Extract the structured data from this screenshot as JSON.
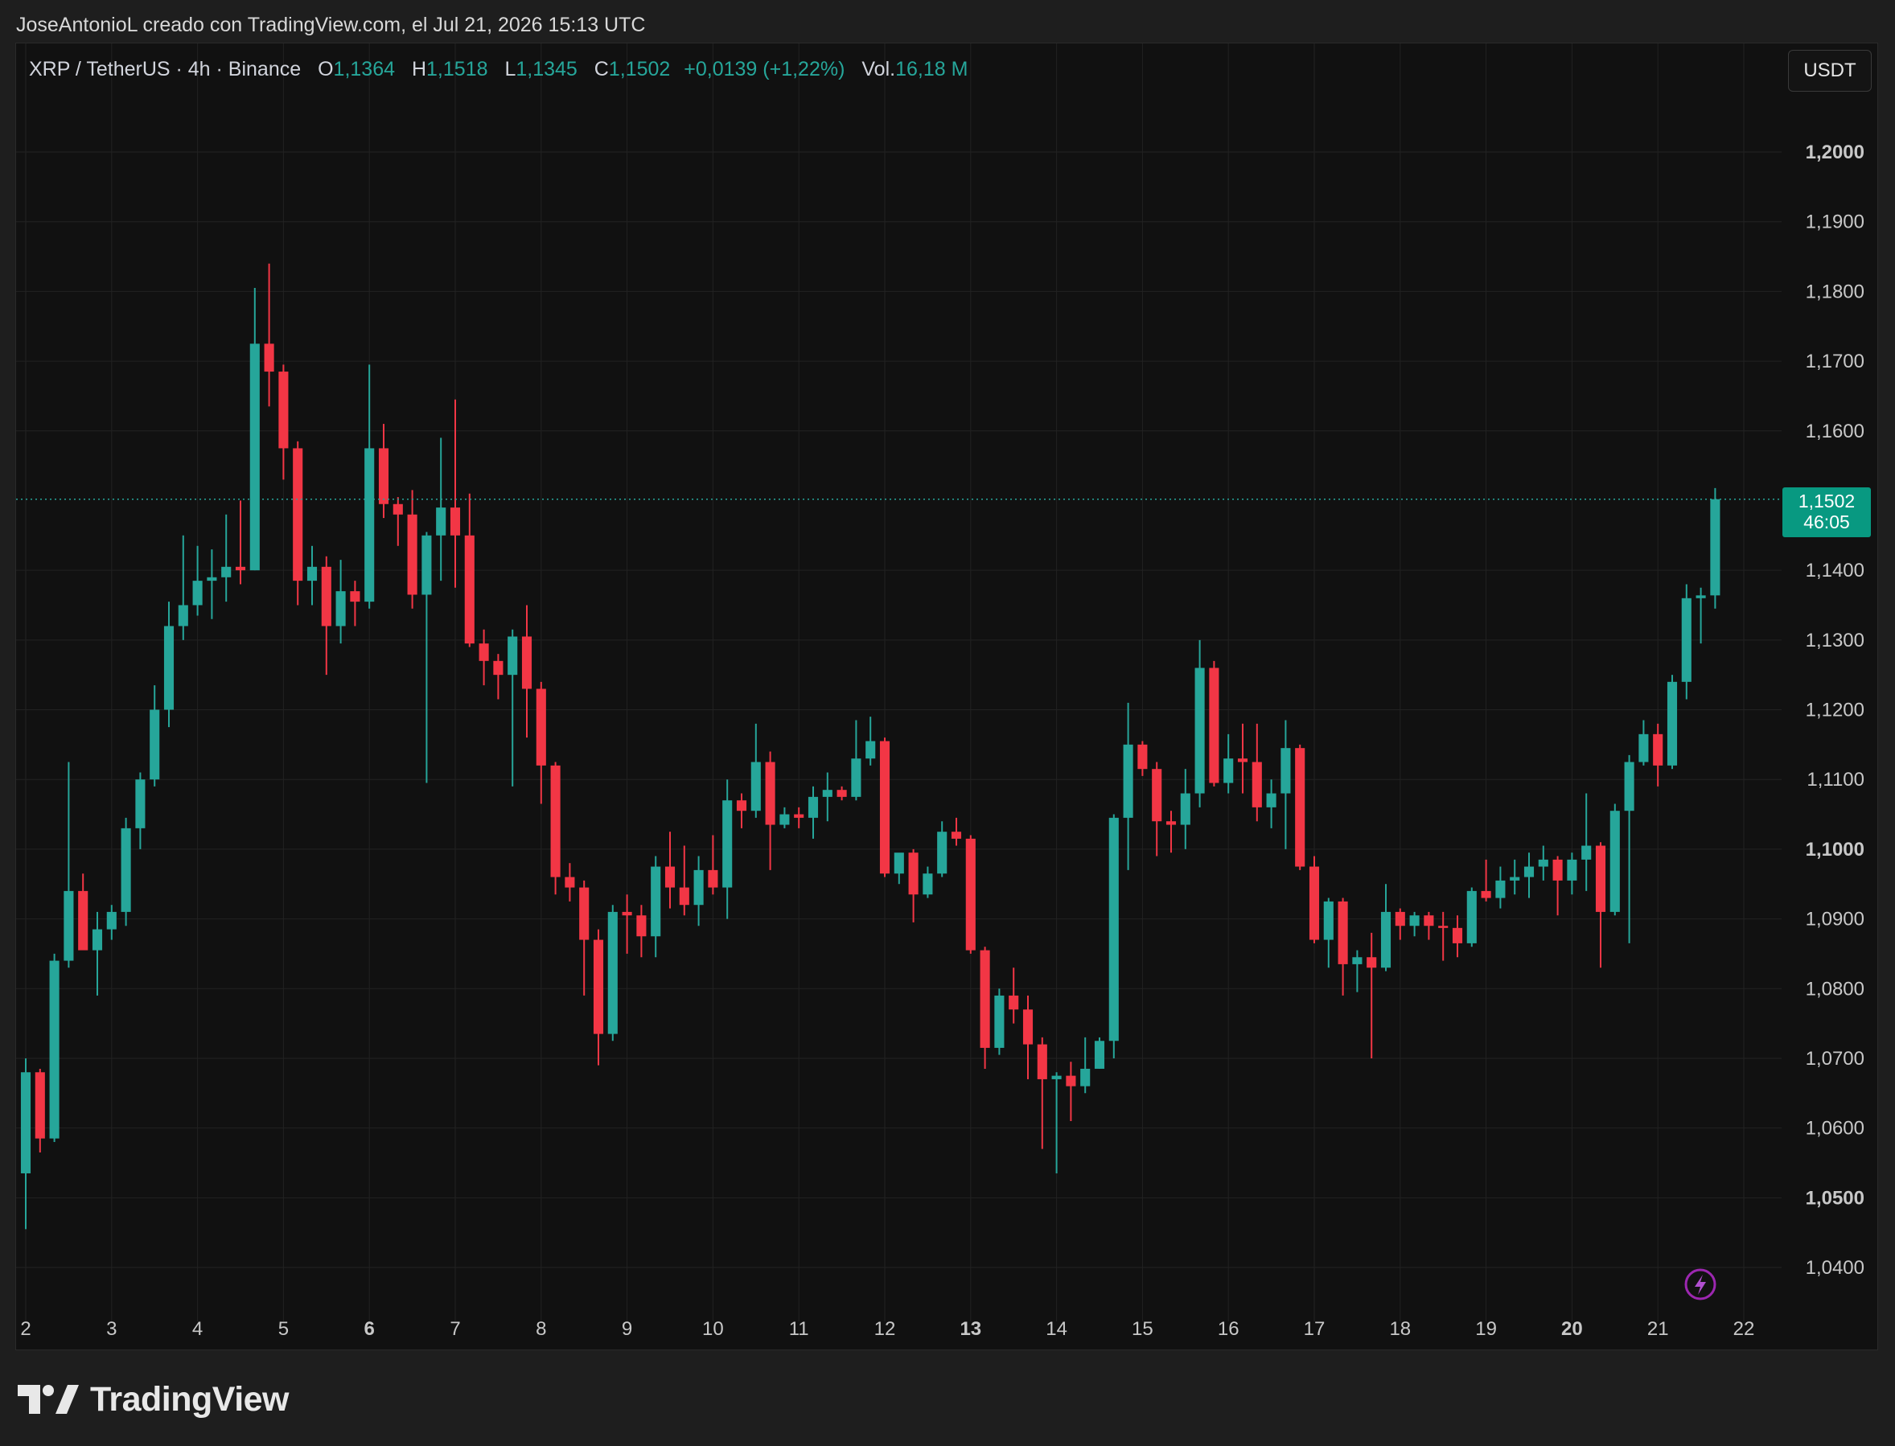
{
  "header": {
    "attribution": "JoseAntonioL creado con TradingView.com, el Jul 21, 2026 15:13 UTC"
  },
  "legend": {
    "symbol": "XRP / TetherUS · 4h · Binance",
    "open_label": "O",
    "open": "1,1364",
    "high_label": "H",
    "high": "1,1518",
    "low_label": "L",
    "low": "1,1345",
    "close_label": "C",
    "close": "1,1502",
    "change": "+0,0139 (+1,22%)",
    "volume_label": "Vol.",
    "volume": "16,18 M"
  },
  "currency_button": "USDT",
  "price_tag": {
    "price": "1,1502",
    "countdown": "46:05"
  },
  "brand": {
    "name": "TradingView"
  },
  "colors": {
    "up": "#26a69a",
    "down": "#f23645",
    "background": "#111111",
    "grid": "#222222",
    "text": "#c8c8c8"
  },
  "icons": {
    "brand": "tradingview-logo-icon",
    "flash": "lightning-icon"
  },
  "chart_data": {
    "type": "candlestick",
    "title": "XRP / TetherUS · 4h · Binance",
    "x_ticks": [
      {
        "label": "2",
        "bold": false
      },
      {
        "label": "3",
        "bold": false
      },
      {
        "label": "4",
        "bold": false
      },
      {
        "label": "5",
        "bold": false
      },
      {
        "label": "6",
        "bold": true
      },
      {
        "label": "7",
        "bold": false
      },
      {
        "label": "8",
        "bold": false
      },
      {
        "label": "9",
        "bold": false
      },
      {
        "label": "10",
        "bold": false
      },
      {
        "label": "11",
        "bold": false
      },
      {
        "label": "12",
        "bold": false
      },
      {
        "label": "13",
        "bold": true
      },
      {
        "label": "14",
        "bold": false
      },
      {
        "label": "15",
        "bold": false
      },
      {
        "label": "16",
        "bold": false
      },
      {
        "label": "17",
        "bold": false
      },
      {
        "label": "18",
        "bold": false
      },
      {
        "label": "19",
        "bold": false
      },
      {
        "label": "20",
        "bold": true
      },
      {
        "label": "21",
        "bold": false
      },
      {
        "label": "22",
        "bold": false
      }
    ],
    "y_ticks": [
      {
        "value": 1.04,
        "label": "1,0400",
        "bold": false
      },
      {
        "value": 1.05,
        "label": "1,0500",
        "bold": true
      },
      {
        "value": 1.06,
        "label": "1,0600",
        "bold": false
      },
      {
        "value": 1.07,
        "label": "1,0700",
        "bold": false
      },
      {
        "value": 1.08,
        "label": "1,0800",
        "bold": false
      },
      {
        "value": 1.09,
        "label": "1,0900",
        "bold": false
      },
      {
        "value": 1.1,
        "label": "1,1000",
        "bold": true
      },
      {
        "value": 1.11,
        "label": "1,1100",
        "bold": false
      },
      {
        "value": 1.12,
        "label": "1,1200",
        "bold": false
      },
      {
        "value": 1.13,
        "label": "1,1300",
        "bold": false
      },
      {
        "value": 1.14,
        "label": "1,1400",
        "bold": false
      },
      {
        "value": 1.16,
        "label": "1,1600",
        "bold": false
      },
      {
        "value": 1.17,
        "label": "1,1700",
        "bold": false
      },
      {
        "value": 1.18,
        "label": "1,1800",
        "bold": false
      },
      {
        "value": 1.19,
        "label": "1,1900",
        "bold": false
      },
      {
        "value": 1.2,
        "label": "1,2000",
        "bold": true
      }
    ],
    "ylim": [
      1.0345,
      1.2215
    ],
    "x_start_day": 2,
    "candles_per_day": 6,
    "current_price": 1.1502,
    "grid": true,
    "candles": [
      {
        "o": 1.0535,
        "h": 1.07,
        "l": 1.0455,
        "c": 1.068
      },
      {
        "o": 1.068,
        "h": 1.0685,
        "l": 1.0565,
        "c": 1.0585
      },
      {
        "o": 1.0585,
        "h": 1.085,
        "l": 1.058,
        "c": 1.084
      },
      {
        "o": 1.084,
        "h": 1.1125,
        "l": 1.083,
        "c": 1.094
      },
      {
        "o": 1.094,
        "h": 1.0965,
        "l": 1.086,
        "c": 1.0855
      },
      {
        "o": 1.0855,
        "h": 1.091,
        "l": 1.079,
        "c": 1.0885
      },
      {
        "o": 1.0885,
        "h": 1.092,
        "l": 1.087,
        "c": 1.091
      },
      {
        "o": 1.091,
        "h": 1.1045,
        "l": 1.089,
        "c": 1.103
      },
      {
        "o": 1.103,
        "h": 1.111,
        "l": 1.1,
        "c": 1.11
      },
      {
        "o": 1.11,
        "h": 1.1235,
        "l": 1.109,
        "c": 1.12
      },
      {
        "o": 1.12,
        "h": 1.1355,
        "l": 1.1175,
        "c": 1.132
      },
      {
        "o": 1.132,
        "h": 1.145,
        "l": 1.13,
        "c": 1.135
      },
      {
        "o": 1.135,
        "h": 1.1435,
        "l": 1.1335,
        "c": 1.1385
      },
      {
        "o": 1.1385,
        "h": 1.143,
        "l": 1.133,
        "c": 1.139
      },
      {
        "o": 1.139,
        "h": 1.148,
        "l": 1.1355,
        "c": 1.1405
      },
      {
        "o": 1.1405,
        "h": 1.15,
        "l": 1.138,
        "c": 1.14
      },
      {
        "o": 1.14,
        "h": 1.1805,
        "l": 1.14,
        "c": 1.1725
      },
      {
        "o": 1.1725,
        "h": 1.184,
        "l": 1.1635,
        "c": 1.1685
      },
      {
        "o": 1.1685,
        "h": 1.1695,
        "l": 1.153,
        "c": 1.1575
      },
      {
        "o": 1.1575,
        "h": 1.1585,
        "l": 1.135,
        "c": 1.1385
      },
      {
        "o": 1.1385,
        "h": 1.1435,
        "l": 1.135,
        "c": 1.1405
      },
      {
        "o": 1.1405,
        "h": 1.142,
        "l": 1.125,
        "c": 1.132
      },
      {
        "o": 1.132,
        "h": 1.1415,
        "l": 1.1295,
        "c": 1.137
      },
      {
        "o": 1.137,
        "h": 1.1385,
        "l": 1.132,
        "c": 1.1355
      },
      {
        "o": 1.1355,
        "h": 1.1695,
        "l": 1.1345,
        "c": 1.1575
      },
      {
        "o": 1.1575,
        "h": 1.161,
        "l": 1.1475,
        "c": 1.1495
      },
      {
        "o": 1.1495,
        "h": 1.1505,
        "l": 1.1435,
        "c": 1.148
      },
      {
        "o": 1.148,
        "h": 1.1515,
        "l": 1.1345,
        "c": 1.1365
      },
      {
        "o": 1.1365,
        "h": 1.1455,
        "l": 1.1095,
        "c": 1.145
      },
      {
        "o": 1.145,
        "h": 1.159,
        "l": 1.1385,
        "c": 1.149
      },
      {
        "o": 1.149,
        "h": 1.1645,
        "l": 1.1375,
        "c": 1.145
      },
      {
        "o": 1.145,
        "h": 1.151,
        "l": 1.129,
        "c": 1.1295
      },
      {
        "o": 1.1295,
        "h": 1.1315,
        "l": 1.1235,
        "c": 1.127
      },
      {
        "o": 1.127,
        "h": 1.128,
        "l": 1.1215,
        "c": 1.125
      },
      {
        "o": 1.125,
        "h": 1.1315,
        "l": 1.109,
        "c": 1.1305
      },
      {
        "o": 1.1305,
        "h": 1.135,
        "l": 1.116,
        "c": 1.123
      },
      {
        "o": 1.123,
        "h": 1.124,
        "l": 1.1065,
        "c": 1.112
      },
      {
        "o": 1.112,
        "h": 1.1125,
        "l": 1.0935,
        "c": 1.096
      },
      {
        "o": 1.096,
        "h": 1.098,
        "l": 1.0925,
        "c": 1.0945
      },
      {
        "o": 1.0945,
        "h": 1.0955,
        "l": 1.079,
        "c": 1.087
      },
      {
        "o": 1.087,
        "h": 1.0885,
        "l": 1.069,
        "c": 1.0735
      },
      {
        "o": 1.0735,
        "h": 1.092,
        "l": 1.0725,
        "c": 1.091
      },
      {
        "o": 1.091,
        "h": 1.0935,
        "l": 1.085,
        "c": 1.0905
      },
      {
        "o": 1.0905,
        "h": 1.092,
        "l": 1.0845,
        "c": 1.0875
      },
      {
        "o": 1.0875,
        "h": 1.099,
        "l": 1.0845,
        "c": 1.0975
      },
      {
        "o": 1.0975,
        "h": 1.1025,
        "l": 1.0915,
        "c": 1.0945
      },
      {
        "o": 1.0945,
        "h": 1.1005,
        "l": 1.0905,
        "c": 1.092
      },
      {
        "o": 1.092,
        "h": 1.099,
        "l": 1.089,
        "c": 1.097
      },
      {
        "o": 1.097,
        "h": 1.102,
        "l": 1.0935,
        "c": 1.0945
      },
      {
        "o": 1.0945,
        "h": 1.11,
        "l": 1.09,
        "c": 1.107
      },
      {
        "o": 1.107,
        "h": 1.108,
        "l": 1.103,
        "c": 1.1055
      },
      {
        "o": 1.1055,
        "h": 1.118,
        "l": 1.1045,
        "c": 1.1125
      },
      {
        "o": 1.1125,
        "h": 1.114,
        "l": 1.097,
        "c": 1.1035
      },
      {
        "o": 1.1035,
        "h": 1.106,
        "l": 1.103,
        "c": 1.105
      },
      {
        "o": 1.105,
        "h": 1.106,
        "l": 1.103,
        "c": 1.1045
      },
      {
        "o": 1.1045,
        "h": 1.109,
        "l": 1.1015,
        "c": 1.1075
      },
      {
        "o": 1.1075,
        "h": 1.111,
        "l": 1.104,
        "c": 1.1085
      },
      {
        "o": 1.1085,
        "h": 1.109,
        "l": 1.107,
        "c": 1.1075
      },
      {
        "o": 1.1075,
        "h": 1.1185,
        "l": 1.107,
        "c": 1.113
      },
      {
        "o": 1.113,
        "h": 1.119,
        "l": 1.112,
        "c": 1.1155
      },
      {
        "o": 1.1155,
        "h": 1.116,
        "l": 1.096,
        "c": 1.0965
      },
      {
        "o": 1.0965,
        "h": 1.099,
        "l": 1.095,
        "c": 1.0995
      },
      {
        "o": 1.0995,
        "h": 1.1,
        "l": 1.0895,
        "c": 1.0935
      },
      {
        "o": 1.0935,
        "h": 1.0975,
        "l": 1.093,
        "c": 1.0965
      },
      {
        "o": 1.0965,
        "h": 1.104,
        "l": 1.096,
        "c": 1.1025
      },
      {
        "o": 1.1025,
        "h": 1.1045,
        "l": 1.1005,
        "c": 1.1015
      },
      {
        "o": 1.1015,
        "h": 1.102,
        "l": 1.085,
        "c": 1.0855
      },
      {
        "o": 1.0855,
        "h": 1.086,
        "l": 1.0685,
        "c": 1.0715
      },
      {
        "o": 1.0715,
        "h": 1.08,
        "l": 1.0705,
        "c": 1.079
      },
      {
        "o": 1.079,
        "h": 1.083,
        "l": 1.075,
        "c": 1.077
      },
      {
        "o": 1.077,
        "h": 1.079,
        "l": 1.067,
        "c": 1.072
      },
      {
        "o": 1.072,
        "h": 1.073,
        "l": 1.057,
        "c": 1.067
      },
      {
        "o": 1.067,
        "h": 1.068,
        "l": 1.0535,
        "c": 1.0675
      },
      {
        "o": 1.0675,
        "h": 1.0695,
        "l": 1.061,
        "c": 1.066
      },
      {
        "o": 1.066,
        "h": 1.073,
        "l": 1.065,
        "c": 1.0685
      },
      {
        "o": 1.0685,
        "h": 1.073,
        "l": 1.0685,
        "c": 1.0725
      },
      {
        "o": 1.0725,
        "h": 1.105,
        "l": 1.07,
        "c": 1.1045
      },
      {
        "o": 1.1045,
        "h": 1.121,
        "l": 1.097,
        "c": 1.115
      },
      {
        "o": 1.115,
        "h": 1.1155,
        "l": 1.1105,
        "c": 1.1115
      },
      {
        "o": 1.1115,
        "h": 1.1125,
        "l": 1.099,
        "c": 1.104
      },
      {
        "o": 1.104,
        "h": 1.1055,
        "l": 1.0995,
        "c": 1.1035
      },
      {
        "o": 1.1035,
        "h": 1.1115,
        "l": 1.1,
        "c": 1.108
      },
      {
        "o": 1.108,
        "h": 1.13,
        "l": 1.106,
        "c": 1.126
      },
      {
        "o": 1.126,
        "h": 1.127,
        "l": 1.109,
        "c": 1.1095
      },
      {
        "o": 1.1095,
        "h": 1.1165,
        "l": 1.108,
        "c": 1.113
      },
      {
        "o": 1.113,
        "h": 1.118,
        "l": 1.108,
        "c": 1.1125
      },
      {
        "o": 1.1125,
        "h": 1.118,
        "l": 1.104,
        "c": 1.106
      },
      {
        "o": 1.106,
        "h": 1.11,
        "l": 1.103,
        "c": 1.108
      },
      {
        "o": 1.108,
        "h": 1.1185,
        "l": 1.1,
        "c": 1.1145
      },
      {
        "o": 1.1145,
        "h": 1.115,
        "l": 1.097,
        "c": 1.0975
      },
      {
        "o": 1.0975,
        "h": 1.099,
        "l": 1.0865,
        "c": 1.087
      },
      {
        "o": 1.087,
        "h": 1.093,
        "l": 1.083,
        "c": 1.0925
      },
      {
        "o": 1.0925,
        "h": 1.093,
        "l": 1.079,
        "c": 1.0835
      },
      {
        "o": 1.0835,
        "h": 1.0855,
        "l": 1.0795,
        "c": 1.0845
      },
      {
        "o": 1.0845,
        "h": 1.088,
        "l": 1.07,
        "c": 1.083
      },
      {
        "o": 1.083,
        "h": 1.095,
        "l": 1.0825,
        "c": 1.091
      },
      {
        "o": 1.091,
        "h": 1.0915,
        "l": 1.087,
        "c": 1.089
      },
      {
        "o": 1.089,
        "h": 1.091,
        "l": 1.0875,
        "c": 1.0905
      },
      {
        "o": 1.0905,
        "h": 1.091,
        "l": 1.087,
        "c": 1.089
      },
      {
        "o": 1.089,
        "h": 1.091,
        "l": 1.084,
        "c": 1.0887
      },
      {
        "o": 1.0887,
        "h": 1.0905,
        "l": 1.0845,
        "c": 1.0865
      },
      {
        "o": 1.0865,
        "h": 1.0945,
        "l": 1.086,
        "c": 1.094
      },
      {
        "o": 1.094,
        "h": 1.0985,
        "l": 1.0925,
        "c": 1.093
      },
      {
        "o": 1.093,
        "h": 1.0975,
        "l": 1.0915,
        "c": 1.0955
      },
      {
        "o": 1.0955,
        "h": 1.0985,
        "l": 1.0935,
        "c": 1.096
      },
      {
        "o": 1.096,
        "h": 1.0995,
        "l": 1.093,
        "c": 1.0975
      },
      {
        "o": 1.0975,
        "h": 1.1005,
        "l": 1.0955,
        "c": 1.0985
      },
      {
        "o": 1.0985,
        "h": 1.099,
        "l": 1.0905,
        "c": 1.0955
      },
      {
        "o": 1.0955,
        "h": 1.0995,
        "l": 1.0935,
        "c": 1.0985
      },
      {
        "o": 1.0985,
        "h": 1.108,
        "l": 1.094,
        "c": 1.1005
      },
      {
        "o": 1.1005,
        "h": 1.101,
        "l": 1.083,
        "c": 1.091
      },
      {
        "o": 1.091,
        "h": 1.1065,
        "l": 1.0905,
        "c": 1.1055
      },
      {
        "o": 1.1055,
        "h": 1.1135,
        "l": 1.0865,
        "c": 1.1125
      },
      {
        "o": 1.1125,
        "h": 1.1185,
        "l": 1.112,
        "c": 1.1165
      },
      {
        "o": 1.1165,
        "h": 1.118,
        "l": 1.109,
        "c": 1.112
      },
      {
        "o": 1.112,
        "h": 1.125,
        "l": 1.1115,
        "c": 1.124
      },
      {
        "o": 1.124,
        "h": 1.138,
        "l": 1.1215,
        "c": 1.136
      },
      {
        "o": 1.136,
        "h": 1.1375,
        "l": 1.1295,
        "c": 1.1364
      },
      {
        "o": 1.1364,
        "h": 1.1518,
        "l": 1.1345,
        "c": 1.1502
      }
    ]
  }
}
